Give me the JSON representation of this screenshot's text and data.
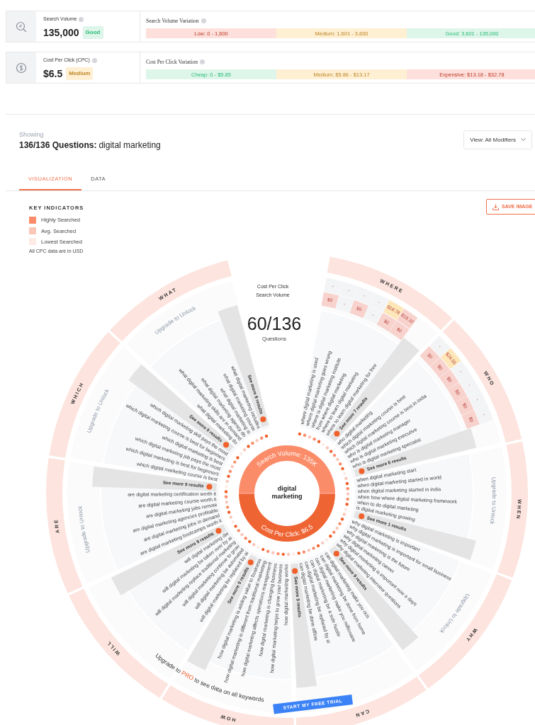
{
  "metrics": [
    {
      "kind": "volume",
      "label": "Search Volume",
      "value": "135,000",
      "badge": "Good",
      "color": "#def5ea",
      "variation_label": "Search Volume Variation",
      "ranges": [
        {
          "text": "Low: 0 - 1,600",
          "color": "#fde0dc"
        },
        {
          "text": "Medium: 1,601 - 3,600",
          "color": "#ffefd3"
        },
        {
          "text": "Good: 3,601 - 135,000",
          "color": "#def5ea"
        }
      ]
    },
    {
      "kind": "cpc",
      "label": "Cost Per Click (CPC)",
      "value": "$6.5",
      "badge": "Medium",
      "color": "#ffefd3",
      "variation_label": "Cost Per Click Variation",
      "ranges": [
        {
          "text": "Cheap: 0 - $5.85",
          "color": "#def5ea"
        },
        {
          "text": "Medium: $5.86 - $13.17",
          "color": "#ffefd3"
        },
        {
          "text": "Expensive: $13.18 - $32.78",
          "color": "#fde0dc"
        }
      ]
    }
  ],
  "showing": {
    "caption": "Showing",
    "count": "136/136 Questions:",
    "keyword": "digital marketing",
    "view_select": "View: All Modifiers"
  },
  "tabs": [
    {
      "label": "VISUALIZATION",
      "selected": true
    },
    {
      "label": "DATA",
      "selected": false
    }
  ],
  "legend": {
    "title": "KEY INDICATORS",
    "items": [
      {
        "label": "Highly Searched",
        "color": "#fb8c69"
      },
      {
        "label": "Avg. Searched",
        "color": "#f9c6b8"
      },
      {
        "label": "Lowest Searched",
        "color": "#feebe6"
      }
    ],
    "note": "All CPC data are in USD"
  },
  "save_button": "SAVE IMAGE",
  "wheel": {
    "toggles": [
      "Cost Per Click",
      "Search Volume"
    ],
    "count": "60/136",
    "count_label": "Questions",
    "center": [
      "digital",
      "marketing"
    ],
    "volume_arc": "Search Volume: 135K",
    "cpc_arc": "Cost Per Click: $6.5",
    "sectors": [
      {
        "label": "WHERE",
        "see_more": "See more 7 results",
        "questions": [
          {
            "text": "where digital marketing is used",
            "cells": [
              {
                "text": "$0",
                "color": "#f8d2cd"
              },
              {
                "text": "-",
                "color": "#f3f4f6"
              }
            ]
          },
          {
            "text": "where digital marketing goes wrong",
            "cells": [
              {
                "text": "-",
                "color": "#f3f4f6"
              },
              {
                "text": "-",
                "color": "#f3f4f6"
              }
            ]
          },
          {
            "text": "where is digital marketing institute",
            "cells": [
              {
                "text": "$0",
                "color": "#f8d2cd"
              },
              {
                "text": "-",
                "color": "#f3f4f6"
              }
            ]
          },
          {
            "text": "from where digital marketing",
            "cells": [
              {
                "text": "-",
                "color": "#f3f4f6"
              },
              {
                "text": "-",
                "color": "#f3f4f6"
              }
            ]
          },
          {
            "text": "where to learn digital marketing",
            "cells": [
              {
                "text": "$0",
                "color": "#f8d2cd"
              },
              {
                "text": "$18.78",
                "color": "#fde6b8"
              }
            ]
          },
          {
            "text": "where to learn digital marketing for free",
            "cells": [
              {
                "text": "$0",
                "color": "#f8d2cd"
              },
              {
                "text": "$18.32",
                "color": "#f8d2cd"
              }
            ]
          }
        ]
      },
      {
        "label": "WHO",
        "see_more": "See more 6 results",
        "questions": [
          {
            "text": "who digital marketing",
            "cells": [
              {
                "text": "$0",
                "color": "#f8d2cd"
              },
              {
                "text": "-",
                "color": "#f3f4f6"
              }
            ]
          },
          {
            "text": "which digital marketing course is best",
            "cells": [
              {
                "text": "$0",
                "color": "#f8d2cd"
              },
              {
                "text": "$24.55",
                "color": "#fde6b8"
              }
            ]
          },
          {
            "text": "which digital marketing course is best in india",
            "cells": [
              {
                "text": "$0",
                "color": "#f8d2cd"
              },
              {
                "text": "-",
                "color": "#f3f4f6"
              }
            ]
          },
          {
            "text": "who is digital marketing manager",
            "cells": [
              {
                "text": "$0",
                "color": "#f8d2cd"
              },
              {
                "text": "-",
                "color": "#f3f4f6"
              }
            ]
          },
          {
            "text": "who is digital marketing executive",
            "cells": [
              {
                "text": "$0",
                "color": "#f8d2cd"
              },
              {
                "text": "-",
                "color": "#f3f4f6"
              }
            ]
          },
          {
            "text": "who is digital marketing specialist",
            "cells": [
              {
                "text": "$0",
                "color": "#f8d2cd"
              },
              {
                "text": "-",
                "color": "#f3f4f6"
              }
            ]
          }
        ]
      },
      {
        "label": "WHEN",
        "see_more": "See more 1 results",
        "locked": "Upgrade to Unlock",
        "questions": [
          {
            "text": "when digital marketing start"
          },
          {
            "text": "when digital marketing started in world"
          },
          {
            "text": "when digital marketing started in india"
          },
          {
            "text": "when how where digital marketing framework"
          },
          {
            "text": "when to do digital marketing"
          },
          {
            "text": "is digital marketing growing"
          }
        ]
      },
      {
        "label": "WHY",
        "see_more": "See more 9 results",
        "locked": "Upgrade to Unlock",
        "questions": [
          {
            "text": "why digital marketing is important"
          },
          {
            "text": "why digital marketing is important for small business"
          },
          {
            "text": "why digital marketing is the future"
          },
          {
            "text": "why digital marketing career"
          },
          {
            "text": "why digital marketing is important now a days"
          },
          {
            "text": "why digital marketing interview questions"
          }
        ]
      },
      {
        "label": "CAN",
        "see_more": "See more 9 results",
        "questions": [
          {
            "text": "can digital marketing make you rich"
          },
          {
            "text": "can digital marketing be done from home"
          },
          {
            "text": "can digital marketing make you millionaire"
          },
          {
            "text": "can digital marketing be a side hustle"
          },
          {
            "text": "can digital marketing be replaced by ai"
          },
          {
            "text": "can digital marketing be done offline"
          }
        ]
      },
      {
        "label": "HOW",
        "see_more": "See more 9 results",
        "questions": [
          {
            "text": "how digital marketing is adding value to business"
          },
          {
            "text": "how digital marketing is different from traditional marketing"
          },
          {
            "text": "how digital marketing affects operations management"
          },
          {
            "text": "how digital marketing is changing business"
          },
          {
            "text": "how digital marketing helps to grow your business"
          },
          {
            "text": "how digital marketing works"
          }
        ]
      },
      {
        "label": "WILL",
        "see_more": "See more 9 results",
        "questions": [
          {
            "text": "will digital marketing die"
          },
          {
            "text": "will digital marketing be taken over by ai"
          },
          {
            "text": "will digital marketing replace traditional marketing"
          },
          {
            "text": "will digital marketing continue to grow"
          },
          {
            "text": "will digital marketing be automated"
          },
          {
            "text": "will digital marketing be replaced by ai"
          }
        ]
      },
      {
        "label": "ARE",
        "see_more": "See more 9 results",
        "locked": "Upgrade to Unlock",
        "questions": [
          {
            "text": "are digital marketing certification worth it"
          },
          {
            "text": "are digital marketing course worth it"
          },
          {
            "text": "are digital marketing jobs remote"
          },
          {
            "text": "are digital marketing agencies profitable"
          },
          {
            "text": "are digital marketing jobs in demand"
          },
          {
            "text": "are digital marketing bootcamps worth it"
          }
        ]
      },
      {
        "label": "WHICH",
        "see_more": "See more 9 results",
        "locked": "Upgrade to Unlock",
        "questions": [
          {
            "text": "which digital marketing skill pays the most"
          },
          {
            "text": "which digital marketing course is best for beginners"
          },
          {
            "text": "which digital marketing is best"
          },
          {
            "text": "which digital marketing job pays the most"
          },
          {
            "text": "which digital marketing is best for beginners"
          },
          {
            "text": "which digital marketing course is best"
          }
        ]
      },
      {
        "label": "WHAT",
        "see_more": "See more 9 results",
        "locked": "Upgrade to Unlock",
        "questions": [
          {
            "text": "what digital marketing includes"
          },
          {
            "text": "what digital marketing course"
          },
          {
            "text": "what digital marketing is"
          },
          {
            "text": "what digital marketing agency do"
          },
          {
            "text": "what digital marketing skills are in demand"
          },
          {
            "text": "what digital marketing do"
          }
        ]
      }
    ],
    "upgrade_prompt": {
      "before": "Upgrade to",
      "highlight": "PRO",
      "after": "to see data on all keywords"
    },
    "trial_button": "START MY FREE TRIAL"
  }
}
